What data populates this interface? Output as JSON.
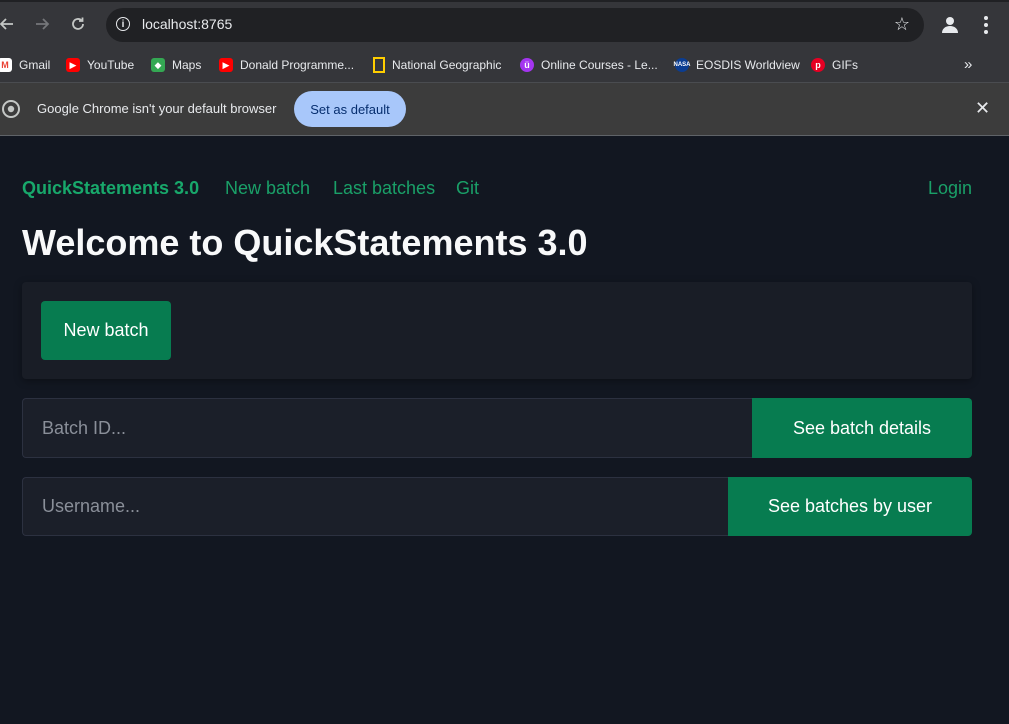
{
  "browser": {
    "url": "localhost:8765",
    "bookmarks": [
      {
        "label": "Gmail",
        "icon": "gmail-icon",
        "color": "#ea4335"
      },
      {
        "label": "YouTube",
        "icon": "youtube-icon",
        "color": "#ff0000"
      },
      {
        "label": "Maps",
        "icon": "maps-icon",
        "color": "#34a853"
      },
      {
        "label": "Donald Programme...",
        "icon": "youtube-icon",
        "color": "#ff0000"
      },
      {
        "label": "National Geographic",
        "icon": "natgeo-icon",
        "color": "#ffce00"
      },
      {
        "label": "Online Courses - Le...",
        "icon": "udemy-icon",
        "color": "#a435f0"
      },
      {
        "label": "EOSDIS Worldview",
        "icon": "nasa-icon",
        "color": "#0b3d91"
      },
      {
        "label": "GIFs",
        "icon": "pinterest-icon",
        "color": "#e60023"
      }
    ],
    "more_bookmarks": "»",
    "infobar": {
      "message": "Google Chrome isn't your default browser",
      "button": "Set as default"
    }
  },
  "app": {
    "brand": "QuickStatements 3.0",
    "nav": [
      "New batch",
      "Last batches",
      "Git"
    ],
    "login": "Login",
    "heading": "Welcome to QuickStatements 3.0",
    "new_batch_button": "New batch",
    "batch_id": {
      "placeholder": "Batch ID...",
      "button": "See batch details"
    },
    "username": {
      "placeholder": "Username...",
      "button": "See batches by user"
    }
  },
  "colors": {
    "accent": "#077c50",
    "link": "#1aa068",
    "background": "#121721"
  }
}
